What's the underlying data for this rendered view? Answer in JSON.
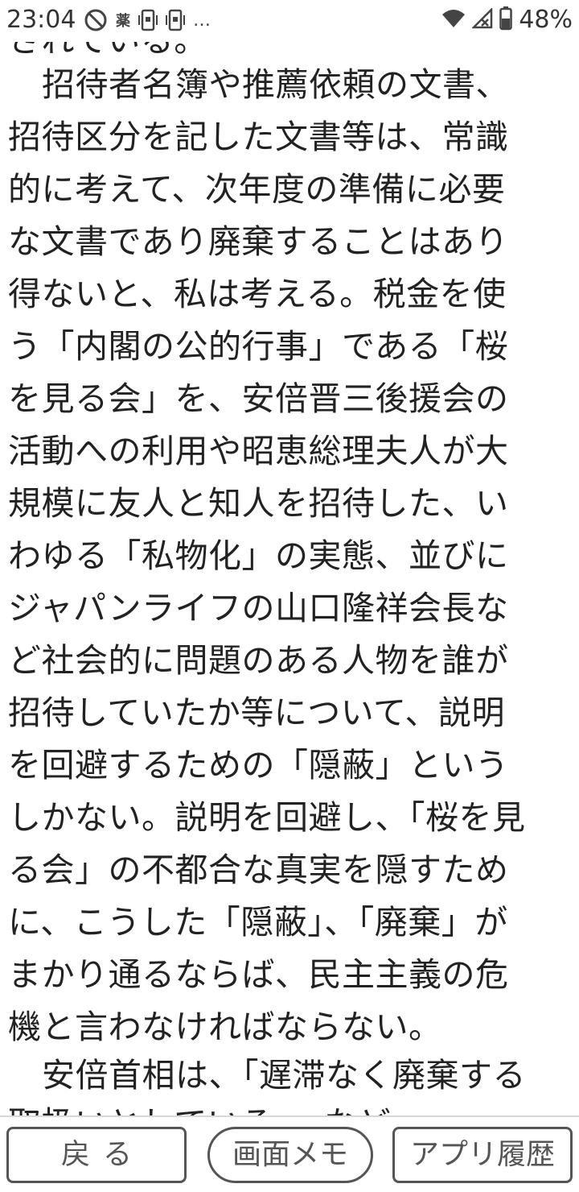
{
  "status_bar": {
    "time": "23:04",
    "left_icons": [
      "block-icon",
      "medicine-icon",
      "phone-icon",
      "phone-icon",
      "more-icon"
    ],
    "medicine_glyph": "薬",
    "more_glyph": "…",
    "battery_text": "48%"
  },
  "article": {
    "lines": [
      "されている。",
      "招待者名簿や推薦依頼の文書、",
      "招待区分を記した文書等は、常識",
      "的に考えて、次年度の準備に必要",
      "な文書であり廃棄することはあり",
      "得ないと、私は考える。税金を使",
      "う「内閣の公的行事」である「桜",
      "を見る会」を、安倍晋三後援会の",
      "活動への利用や昭恵総理夫人が大",
      "規模に友人と知人を招待した、い",
      "わゆる「私物化」の実態、並びに",
      "ジャパンライフの山口隆祥会長な",
      "ど社会的に問題のある人物を誰が",
      "招待していたか等について、説明",
      "を回避するための「隠蔽」という",
      "しかない。説明を回避し、「桜を見",
      "る会」の不都合な真実を隠すため",
      "に、こうした「隠蔽」、「廃棄」が",
      "まかり通るならば、民主主義の危",
      "機と言わなければならない。",
      "安倍首相は、「遅滞なく廃棄する",
      "取扱いとしている。」など"
    ]
  },
  "bottom_bar": {
    "back_label": "戻る",
    "memo_label": "画面メモ",
    "history_label": "アプリ履歴"
  }
}
